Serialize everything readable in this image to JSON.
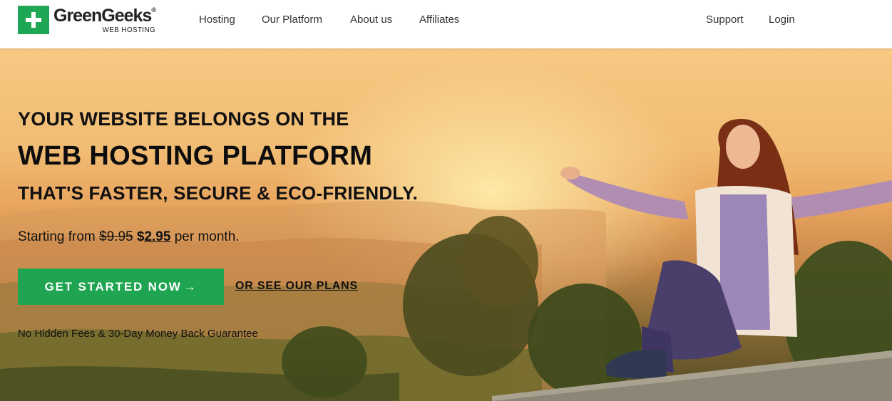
{
  "brand": {
    "name": "GreenGeeks",
    "registered_mark": "®",
    "tagline": "WEB HOSTING",
    "color": "#1fa755"
  },
  "nav": {
    "left": [
      "Hosting",
      "Our Platform",
      "About us",
      "Affiliates"
    ],
    "right": [
      "Support",
      "Login"
    ]
  },
  "hero": {
    "line1": "YOUR WEBSITE BELONGS ON THE",
    "line2": "WEB HOSTING PLATFORM",
    "line3": "THAT'S FASTER, SECURE & ECO-FRIENDLY.",
    "price_prefix": "Starting from",
    "price_old": "$9.95",
    "price_currency": "$",
    "price_new": "2.95",
    "price_suffix": "per month.",
    "cta_label": "GET STARTED NOW",
    "cta_arrow": "→",
    "cta_color": "#1fa551",
    "plans_link": "OR SEE OUR PLANS",
    "guarantee": "No Hidden Fees & 30-Day Money Back Guarantee"
  }
}
